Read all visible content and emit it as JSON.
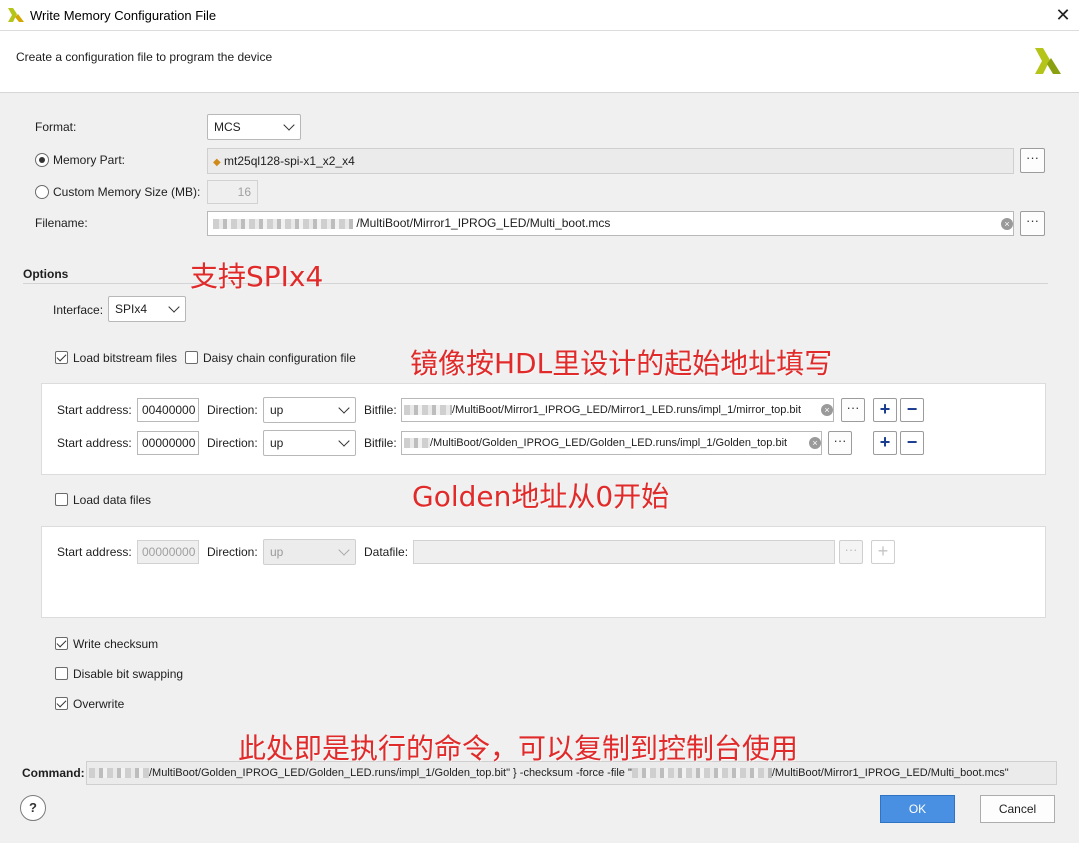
{
  "window": {
    "title": "Write Memory Configuration File",
    "close": "✕",
    "header": "Create a configuration file to program the device"
  },
  "format": {
    "label": "Format:",
    "value": "MCS"
  },
  "memory_part": {
    "label": "Memory Part:",
    "value": "mt25ql128-spi-x1_x2_x4"
  },
  "custom_size": {
    "label": "Custom Memory Size (MB):",
    "value": "16"
  },
  "filename": {
    "label": "Filename:",
    "value": "/MultiBoot/Mirror1_IPROG_LED/Multi_boot.mcs"
  },
  "options": {
    "title": "Options",
    "interface_label": "Interface:",
    "interface_value": "SPIx4",
    "load_bitstream": "Load bitstream files",
    "daisy_chain": "Daisy chain configuration file",
    "load_data": "Load data files",
    "write_checksum": "Write checksum",
    "disable_bit_swapping": "Disable bit swapping",
    "overwrite": "Overwrite"
  },
  "bit_rows": [
    {
      "start_label": "Start address:",
      "start": "00400000",
      "dir_label": "Direction:",
      "dir": "up",
      "file_label": "Bitfile:",
      "file": "/MultiBoot/Mirror1_IPROG_LED/Mirror1_LED.runs/impl_1/mirror_top.bit"
    },
    {
      "start_label": "Start address:",
      "start": "00000000",
      "dir_label": "Direction:",
      "dir": "up",
      "file_label": "Bitfile:",
      "file": "/MultiBoot/Golden_IPROG_LED/Golden_LED.runs/impl_1/Golden_top.bit"
    }
  ],
  "data_row": {
    "start_label": "Start address:",
    "start": "00000000",
    "dir_label": "Direction:",
    "dir": "up",
    "file_label": "Datafile:"
  },
  "command": {
    "label": "Command:",
    "part1": "/MultiBoot/Golden_IPROG_LED/Golden_LED.runs/impl_1/Golden_top.bit\" } -checksum -force -file \"",
    "part2": "/MultiBoot/Mirror1_IPROG_LED/Multi_boot.mcs\""
  },
  "buttons": {
    "ok": "OK",
    "cancel": "Cancel",
    "help": "?",
    "browse": "···",
    "add": "+",
    "remove": "−",
    "clear": "×"
  },
  "annotations": {
    "spi": "支持SPIx4",
    "hdl": "镜像按HDL里设计的起始地址填写",
    "golden": "Golden地址从0开始",
    "command": "此处即是执行的命令，可以复制到控制台使用"
  },
  "colors": {
    "annotation": "#e12a2a",
    "ok_button": "#4a90e2",
    "plus_minus": "#1a3d8f",
    "logo": "#b5c419"
  }
}
